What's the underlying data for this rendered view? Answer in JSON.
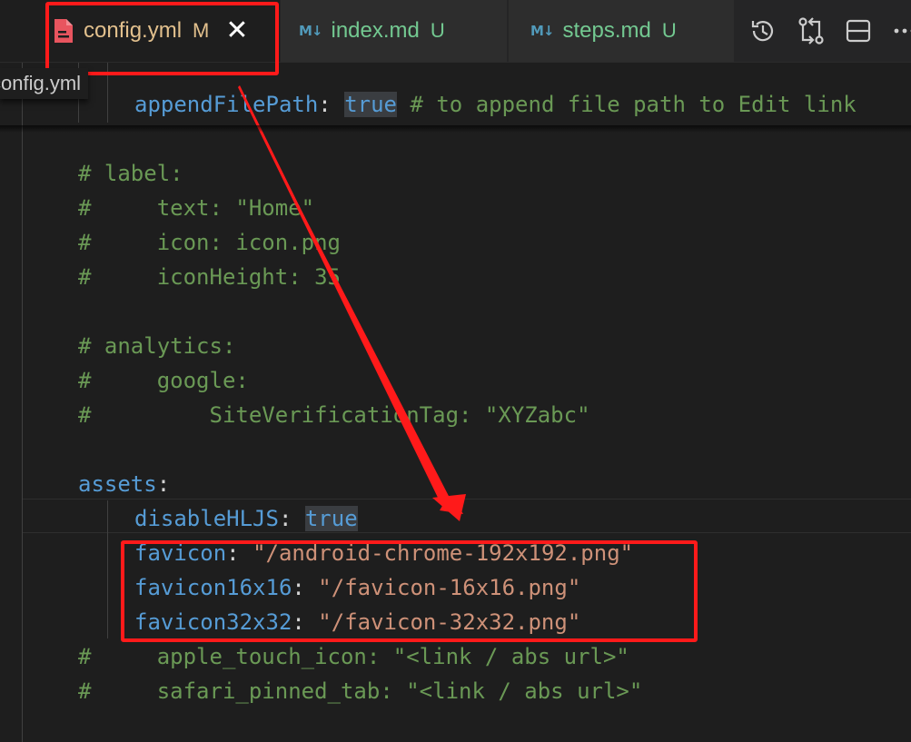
{
  "tabs": [
    {
      "label": "config.yml",
      "status": "M",
      "icon": "yaml-file-icon"
    },
    {
      "label": "index.md",
      "status": "U",
      "icon": "markdown-icon"
    },
    {
      "label": "steps.md",
      "status": "U",
      "icon": "markdown-icon"
    }
  ],
  "tab_icon_glyph": "M↓",
  "close_glyph": "✕",
  "actions": [
    "timeline-icon",
    "compare-changes-icon",
    "split-editor-icon",
    "more-actions-icon"
  ],
  "breadcrumb": "config.yml",
  "code": {
    "l1_key": "appendFilePath",
    "l1_colon": ":",
    "l1_value": "true",
    "l1_comment": "# to append file path to Edit link",
    "l2": "# label:",
    "l3": "#     text: \"Home\"",
    "l4": "#     icon: icon.png",
    "l5": "#     iconHeight: 35",
    "l6": "# analytics:",
    "l7": "#     google:",
    "l8": "#         SiteVerificationTag: \"XYZabc\"",
    "l9_key": "assets",
    "l9_colon": ":",
    "l10_key": "disableHLJS",
    "l10_colon": ": ",
    "l10_value": "true",
    "l11_key": "favicon",
    "l11_colon": ": ",
    "l11_value": "\"/android-chrome-192x192.png\"",
    "l12_key": "favicon16x16",
    "l12_colon": ": ",
    "l12_value": "\"/favicon-16x16.png\"",
    "l13_key": "favicon32x32",
    "l13_colon": ": ",
    "l13_value": "\"/favicon-32x32.png\"",
    "l14": "#     apple_touch_icon: \"<link / abs url>\"",
    "l15": "#     safari_pinned_tab: \"<link / abs url>\""
  },
  "colors": {
    "annotation": "#ff1a1a",
    "keyword": "#569cd6",
    "string": "#ce9178",
    "comment": "#6a9955",
    "modified": "#e2c08d",
    "untracked": "#73c991"
  }
}
